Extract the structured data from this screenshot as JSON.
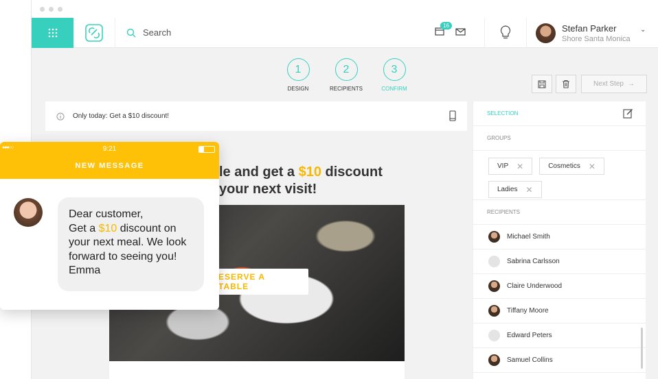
{
  "header": {
    "search_placeholder": "Search",
    "notification_count": "16",
    "user": {
      "name": "Stefan Parker",
      "location": "Shore Santa Monica"
    }
  },
  "steps": [
    {
      "number": "1",
      "label": "DESIGN",
      "active": false
    },
    {
      "number": "2",
      "label": "RECIPIENTS",
      "active": false
    },
    {
      "number": "3",
      "label": "CONFIRM",
      "active": true
    }
  ],
  "toolbar": {
    "next_label": "Next Step"
  },
  "preview": {
    "info_text": "Only today: Get a $10 discount!",
    "headline_line1_pre": "le and get a ",
    "headline_amount": "$10",
    "headline_line1_post": " discount",
    "headline_line2": "your next visit!",
    "cta_label": "ESERVE A TABLE"
  },
  "sidebar": {
    "selection_label": "SELECTION",
    "groups_label": "GROUPS",
    "groups": [
      "VIP",
      "Cosmetics",
      "Ladies"
    ],
    "recipients_label": "RECIPIENTS",
    "recipients": [
      {
        "name": "Michael Smith",
        "has_photo": true
      },
      {
        "name": "Sabrina Carlsson",
        "has_photo": false
      },
      {
        "name": "Claire Underwood",
        "has_photo": true
      },
      {
        "name": "Tiffany Moore",
        "has_photo": true
      },
      {
        "name": "Edward Peters",
        "has_photo": false
      },
      {
        "name": "Samuel Collins",
        "has_photo": true
      }
    ]
  },
  "sms": {
    "time": "9:21",
    "title": "NEW MESSAGE",
    "line1": "Dear customer,",
    "line2_pre": "Get a ",
    "line2_amount": "$10",
    "line2_post": " discount on",
    "line3": "your next meal. We look",
    "line4": "forward to seeing you!",
    "line5": "Emma"
  },
  "colors": {
    "accent": "#37d0be",
    "highlight": "#f7b800",
    "sms_header": "#ffc107"
  }
}
